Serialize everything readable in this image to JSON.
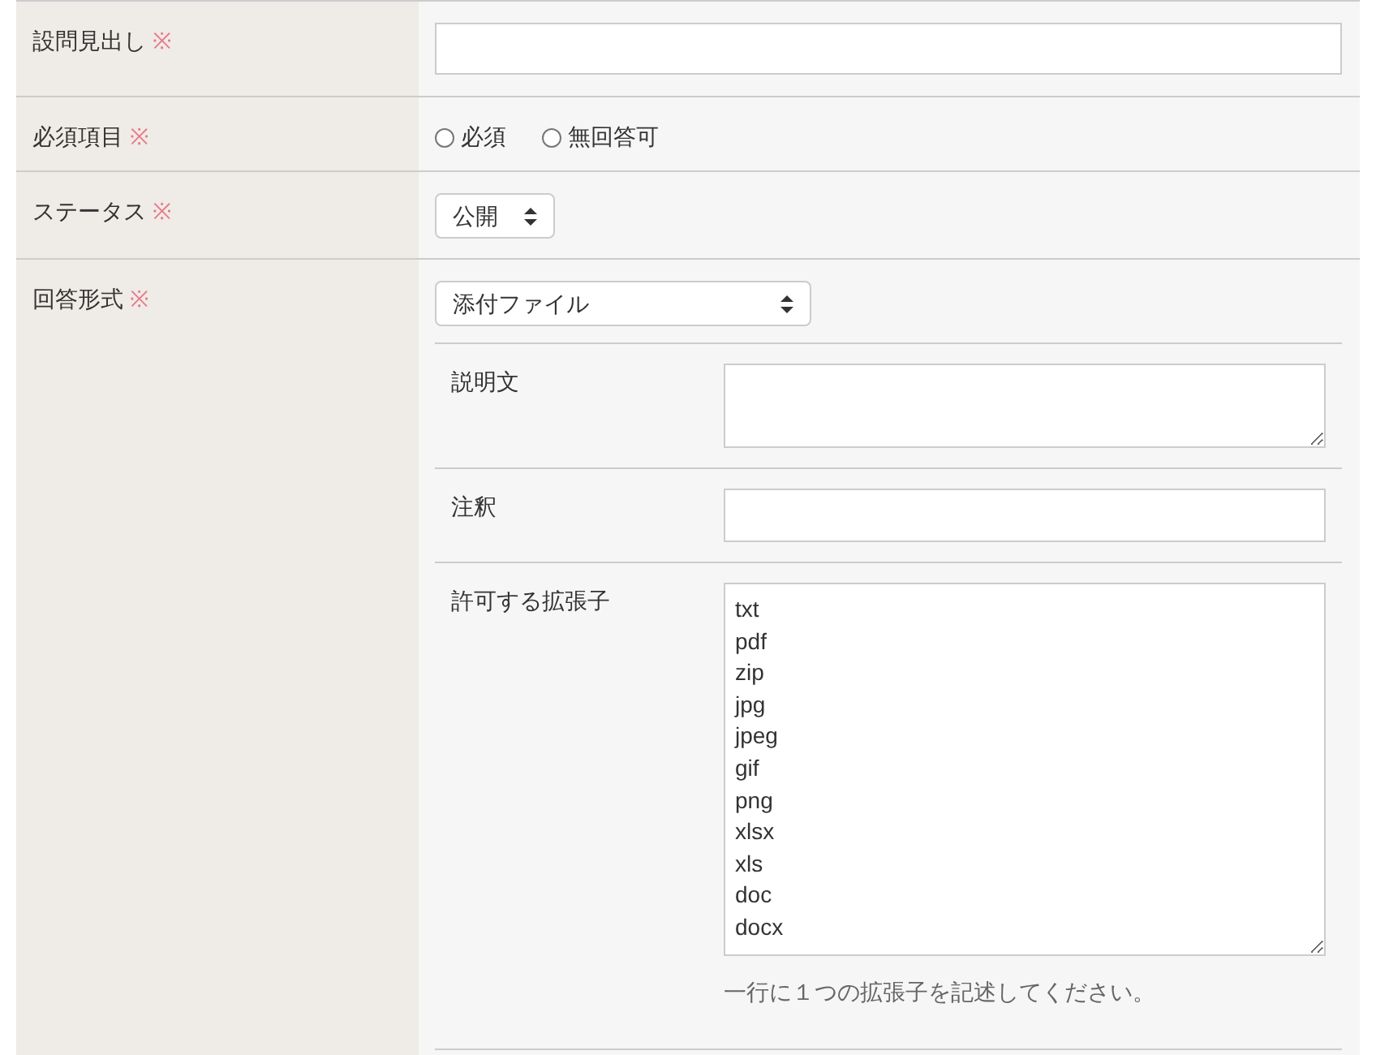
{
  "rows": [
    {
      "kind": "text",
      "label": "設問見出し",
      "required_mark": "※"
    },
    {
      "kind": "radio",
      "label": "必須項目",
      "required_mark": "※",
      "options": [
        {
          "label": "必須",
          "selected": false
        },
        {
          "label": "無回答可",
          "selected": false
        }
      ]
    },
    {
      "kind": "select",
      "label": "ステータス",
      "required_mark": "※",
      "value": "公開"
    },
    {
      "kind": "answer",
      "label": "回答形式",
      "required_mark": "※",
      "value": "添付ファイル",
      "sub_rows": [
        {
          "kind": "textarea",
          "label": "説明文"
        },
        {
          "kind": "text",
          "label": "注釈"
        },
        {
          "kind": "list",
          "label": "許可する拡張子",
          "lines": [
            "txt",
            "pdf",
            "zip",
            "jpg",
            "jpeg",
            "gif",
            "png",
            "xlsx",
            "xls",
            "doc",
            "docx"
          ],
          "hint": "一行に１つの拡張子を記述してください。"
        }
      ]
    }
  ]
}
